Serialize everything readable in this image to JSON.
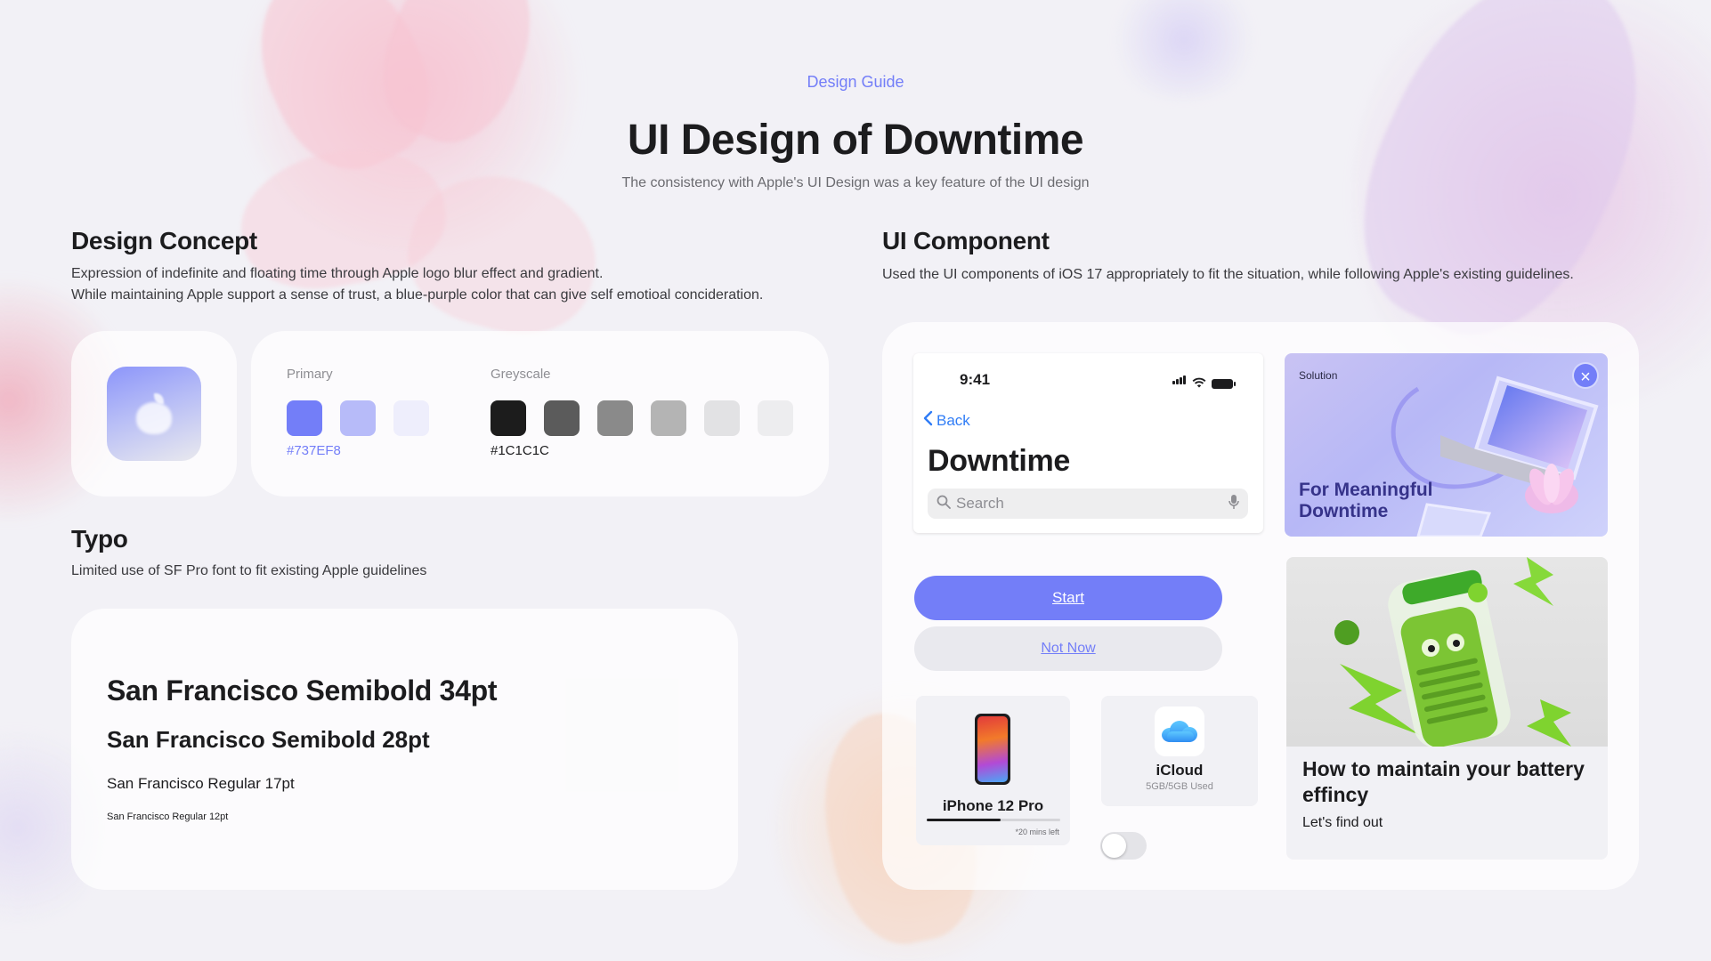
{
  "header": {
    "eyebrow": "Design Guide",
    "title": "UI Design of Downtime",
    "subtitle": "The consistency with Apple's UI Design was a key feature of the UI design"
  },
  "concept": {
    "heading": "Design Concept",
    "line1": "Expression of indefinite and floating time through Apple logo blur effect and gradient.",
    "line2": "While maintaining Apple support a sense of trust, a blue-purple color that can give self emotioal concideration.",
    "logo_icon": "apple-logo-icon"
  },
  "palette": {
    "primary_label": "Primary",
    "primary_hex": "#737EF8",
    "primary_colors": [
      "#737EF8",
      "#B7BBF9",
      "#EEEEFC"
    ],
    "greyscale_label": "Greyscale",
    "greyscale_hex": "#1C1C1C",
    "greyscale_colors": [
      "#1C1C1C",
      "#5B5B5B",
      "#8A8A8A",
      "#B4B4B4",
      "#E2E2E4",
      "#EDEDEF"
    ]
  },
  "typo": {
    "heading": "Typo",
    "desc": "Limited use of SF Pro font to fit existing Apple guidelines",
    "samples": [
      "San Francisco Semibold 34pt",
      "San Francisco Semibold 28pt",
      "San Francisco Regular 17pt",
      "San Francisco Regular 12pt"
    ]
  },
  "component": {
    "heading": "UI Component",
    "desc": "Used the UI components of iOS 17 appropriately to fit the situation, while following Apple's existing guidelines.",
    "phone": {
      "time": "9:41",
      "back": "Back",
      "title": "Downtime",
      "search_placeholder": "Search"
    },
    "hero": {
      "badge": "Solution",
      "title": "For Meaningful Downtime"
    },
    "buttons": {
      "start": "Start",
      "not_now": "Not Now"
    },
    "device": {
      "name": "iPhone 12 Pro",
      "note": "*20 mins left",
      "progress": 0.55
    },
    "icloud": {
      "name": "iCloud",
      "usage": "5GB/5GB Used"
    },
    "toggle_on": false,
    "article": {
      "title": "How to maintain your battery effincy",
      "subtitle": "Let's find out"
    }
  }
}
